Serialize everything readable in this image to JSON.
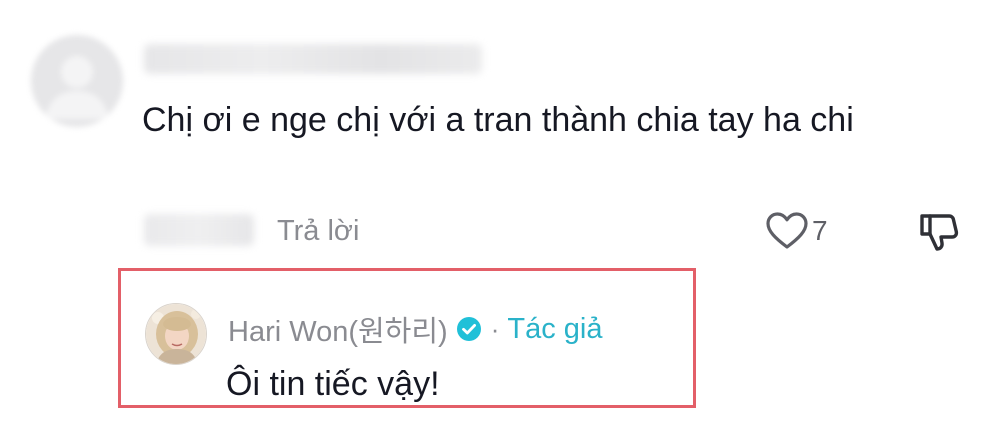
{
  "comment": {
    "text": "Chị ơi e nge chị với a tran thành chia tay ha chi",
    "reply_label": "Trả lời",
    "like_count": "7",
    "icons": {
      "avatar": "default-avatar-icon",
      "like": "heart-outline-icon",
      "dislike": "thumbs-down-icon"
    }
  },
  "reply": {
    "author": "Hari Won(원하리)",
    "separator": "·",
    "author_tag": "Tác giả",
    "text": "Ôi tin tiếc vậy!",
    "icons": {
      "verified": "verified-badge-icon",
      "avatar": "profile-photo"
    },
    "colors": {
      "author_tag": "#2ab2c9",
      "verified": "#20c0d8",
      "highlight_border": "#e35f68"
    }
  }
}
